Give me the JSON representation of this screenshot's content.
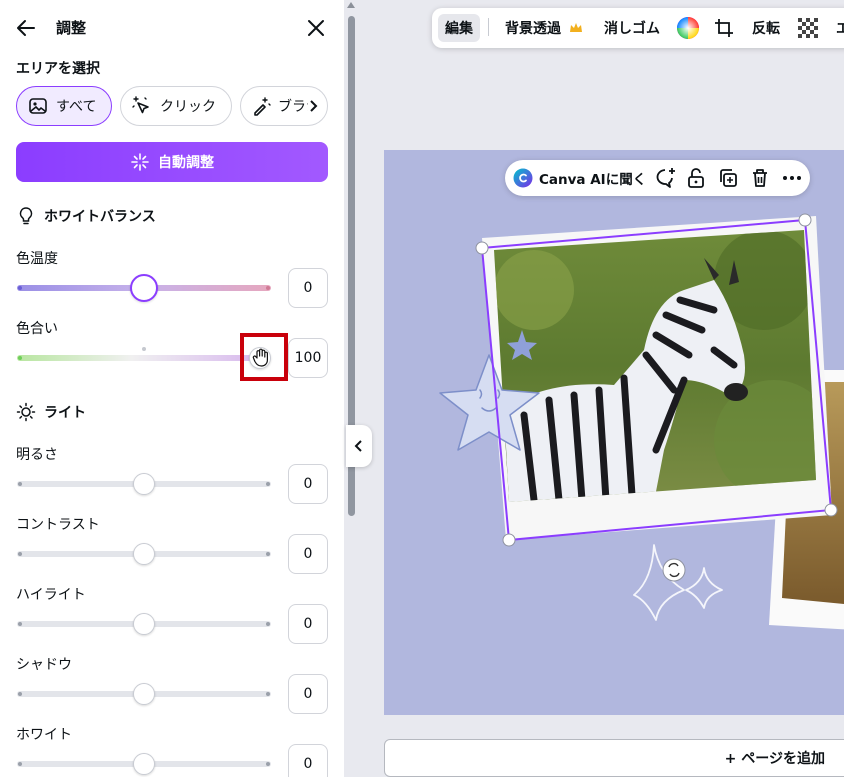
{
  "panel": {
    "title": "調整",
    "area_label": "エリアを選択",
    "area_options": [
      "すべて",
      "クリック",
      "ブラシ"
    ],
    "auto_adjust": "自動調整",
    "white_balance": {
      "heading": "ホワイトバランス",
      "sliders": [
        {
          "label": "色温度",
          "value": "0",
          "level": 0.5
        },
        {
          "label": "色合い",
          "value": "100",
          "level": 1.0
        }
      ]
    },
    "light": {
      "heading": "ライト",
      "sliders": [
        {
          "label": "明るさ",
          "value": "0",
          "level": 0.5
        },
        {
          "label": "コントラスト",
          "value": "0",
          "level": 0.5
        },
        {
          "label": "ハイライト",
          "value": "0",
          "level": 0.5
        },
        {
          "label": "シャドウ",
          "value": "0",
          "level": 0.5
        },
        {
          "label": "ホワイト",
          "value": "0",
          "level": 0.5
        }
      ]
    }
  },
  "toolbar": {
    "edit": "編集",
    "bg_remove": "背景透過",
    "eraser": "消しゴム",
    "flip": "反転",
    "more": "エ"
  },
  "context_menu": {
    "ai": "Canva AIに聞く"
  },
  "footer": {
    "add_page": "+ ページを追加"
  },
  "colors": {
    "accent": "#8b3dff",
    "canvas": "#b1b7de",
    "highlight": "#c9000b"
  }
}
